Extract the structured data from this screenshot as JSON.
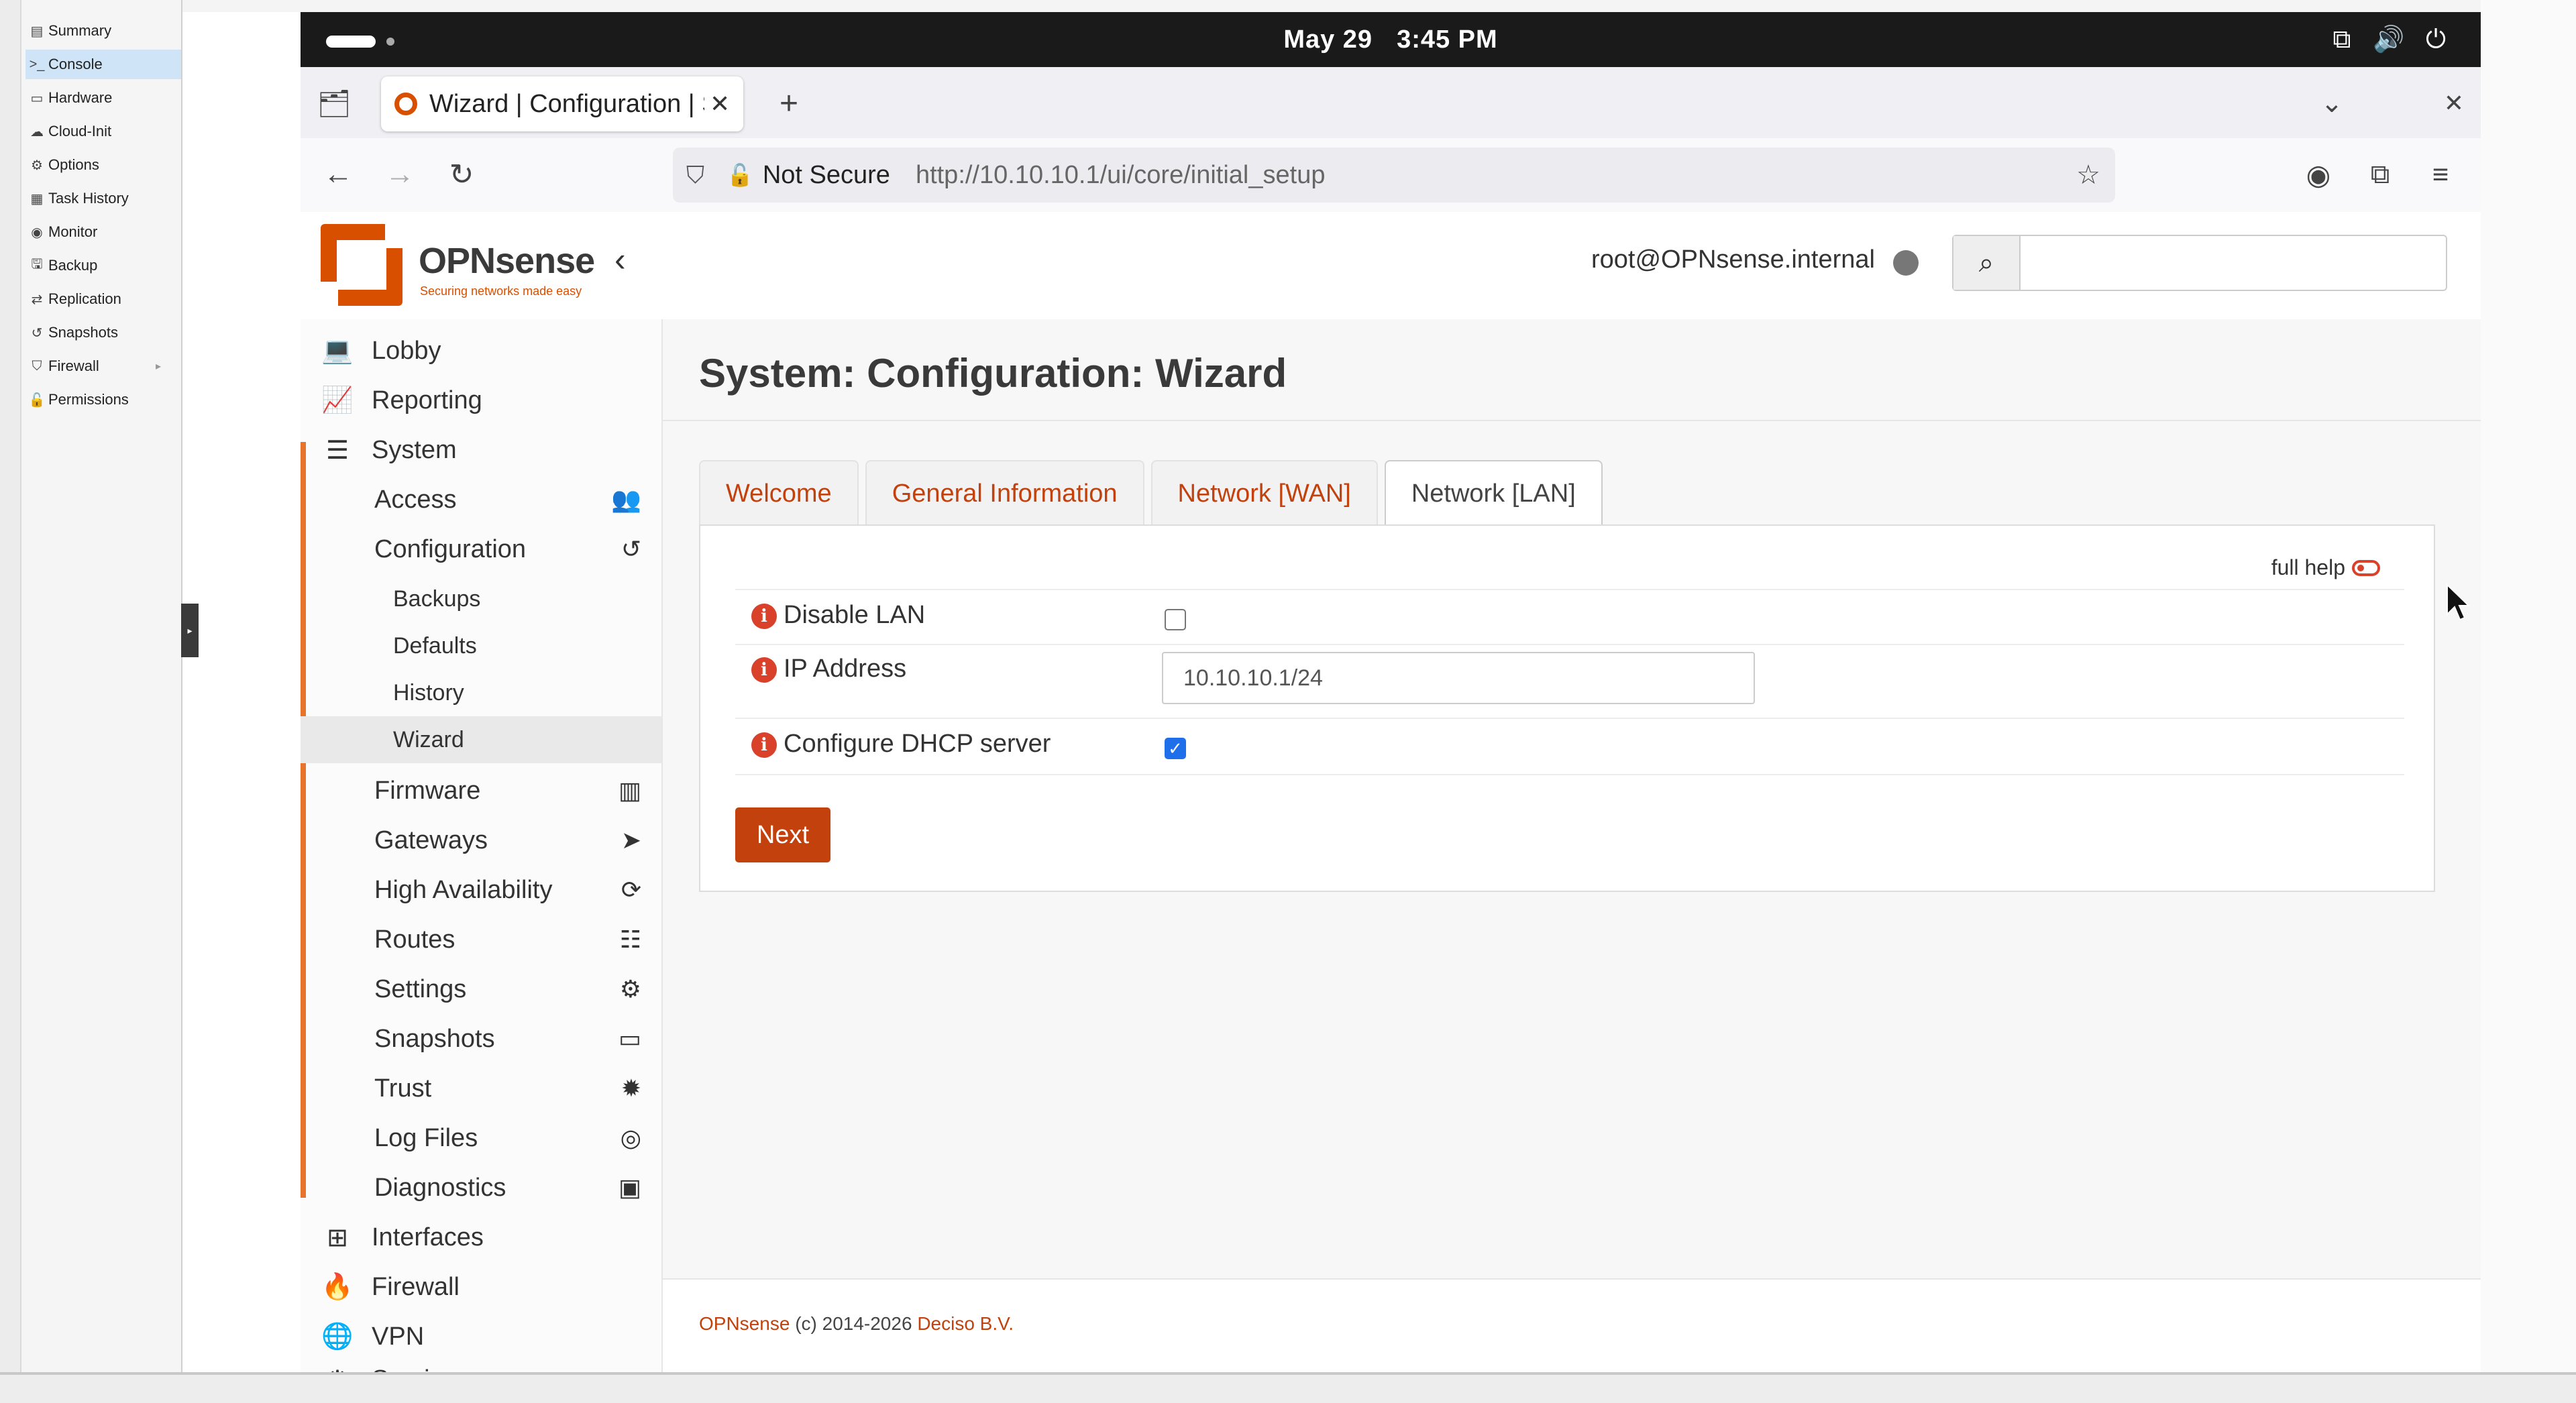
{
  "outer_panel": {
    "items": [
      {
        "icon": "▤",
        "label": "Summary"
      },
      {
        "icon": ">_",
        "label": "Console"
      },
      {
        "icon": "▭",
        "label": "Hardware"
      },
      {
        "icon": "☁",
        "label": "Cloud-Init"
      },
      {
        "icon": "⚙",
        "label": "Options"
      },
      {
        "icon": "▦",
        "label": "Task History"
      },
      {
        "icon": "◉",
        "label": "Monitor"
      },
      {
        "icon": "🖫",
        "label": "Backup"
      },
      {
        "icon": "⇄",
        "label": "Replication"
      },
      {
        "icon": "↺",
        "label": "Snapshots"
      },
      {
        "icon": "⛉",
        "label": "Firewall"
      },
      {
        "icon": "🔓",
        "label": "Permissions"
      }
    ]
  },
  "system_bar": {
    "date": "May 29",
    "time": "3:45 PM"
  },
  "browser": {
    "tab_title": "Wizard | Configuration | S",
    "url_security": "Not Secure",
    "url": "http://10.10.10.1/ui/core/initial_setup"
  },
  "header": {
    "brand": "OPNsense",
    "tagline": "Securing networks made easy",
    "user": "root@OPNsense.internal"
  },
  "nav": {
    "top": [
      {
        "icon": "💻",
        "label": "Lobby"
      },
      {
        "icon": "📈",
        "label": "Reporting"
      },
      {
        "icon": "☰",
        "label": "System"
      }
    ],
    "system_sub": [
      {
        "label": "Access",
        "icon": "👥"
      },
      {
        "label": "Configuration",
        "icon": "↺"
      }
    ],
    "config_sub": [
      "Backups",
      "Defaults",
      "History",
      "Wizard"
    ],
    "system_rest": [
      {
        "label": "Firmware",
        "icon": "▥"
      },
      {
        "label": "Gateways",
        "icon": "➤"
      },
      {
        "label": "High Availability",
        "icon": "⟳"
      },
      {
        "label": "Routes",
        "icon": "☷"
      },
      {
        "label": "Settings",
        "icon": "⚙"
      },
      {
        "label": "Snapshots",
        "icon": "▭"
      },
      {
        "label": "Trust",
        "icon": "✹"
      },
      {
        "label": "Log Files",
        "icon": "◎"
      },
      {
        "label": "Diagnostics",
        "icon": "▣"
      }
    ],
    "bottom": [
      {
        "icon": "⊞",
        "label": "Interfaces"
      },
      {
        "icon": "🔥",
        "label": "Firewall"
      },
      {
        "icon": "🌐",
        "label": "VPN"
      },
      {
        "icon": "⚙",
        "label": "Services"
      }
    ]
  },
  "content": {
    "title": "System: Configuration: Wizard",
    "tabs": [
      "Welcome",
      "General Information",
      "Network [WAN]",
      "Network [LAN]"
    ],
    "active_tab": "Network [LAN]",
    "full_help": "full help",
    "fields": {
      "disable_lan": {
        "label": "Disable LAN",
        "checked": false
      },
      "ip_address": {
        "label": "IP Address",
        "value": "10.10.10.1/24"
      },
      "dhcp": {
        "label": "Configure DHCP server",
        "checked": true
      }
    },
    "next_label": "Next"
  },
  "footer": {
    "brand": "OPNsense",
    "copy": "(c) 2014-2026",
    "company": "Deciso B.V."
  },
  "colors": {
    "accent": "#d94f00",
    "link": "#c2410c",
    "checkbox": "#1f6feb"
  }
}
